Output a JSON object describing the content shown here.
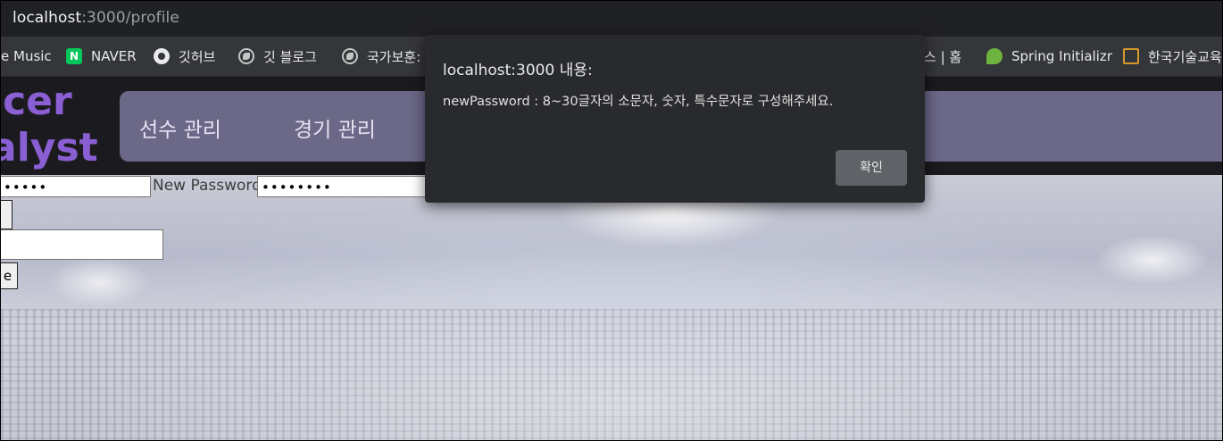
{
  "address_bar": {
    "url_host": "localhost",
    "url_path": ":3000/profile"
  },
  "bookmarks": [
    {
      "label": "e Music",
      "icon": "none"
    },
    {
      "label": "NAVER",
      "icon": "naver-icon",
      "icon_text": "N"
    },
    {
      "label": "깃허브",
      "icon": "github-icon"
    },
    {
      "label": "깃 블로그",
      "icon": "globe-icon"
    },
    {
      "label": "국가보훈:",
      "icon": "globe-icon"
    },
    {
      "label": "스 | 홈",
      "icon": "none"
    },
    {
      "label": "Spring Initializr",
      "icon": "spring-icon"
    },
    {
      "label": "한국기술교육",
      "icon": "kt-icon"
    }
  ],
  "logo": {
    "line1": "ccer",
    "line2": "alyst",
    "color": "#8a5fd3"
  },
  "nav": {
    "items": [
      "선수 관리",
      "경기 관리"
    ]
  },
  "form": {
    "current_password_value": "•••••",
    "new_password_label": "New Password",
    "new_password_value": "••••••••",
    "submit_label": "e"
  },
  "dialog": {
    "title": "localhost:3000 내용:",
    "message": "newPassword : 8~30글자의 소문자, 숫자, 특수문자로 구성해주세요.",
    "confirm_label": "확인"
  }
}
